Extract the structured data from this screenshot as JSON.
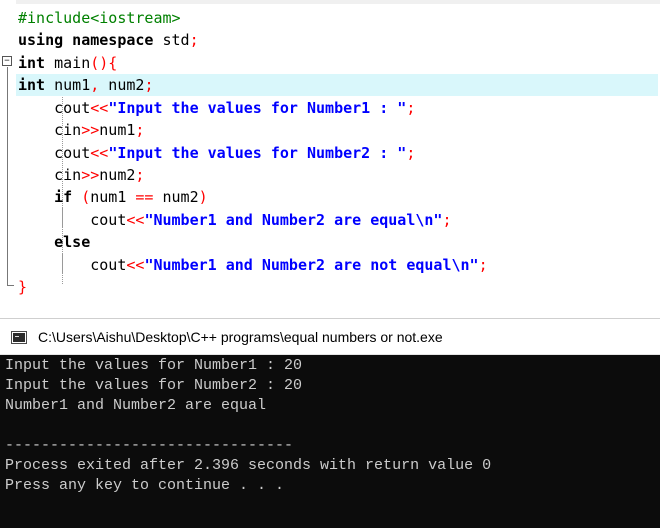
{
  "editor": {
    "lines": [
      {
        "parts": [
          {
            "t": "#include<iostream>",
            "c": "pp"
          }
        ]
      },
      {
        "parts": [
          {
            "t": "using namespace",
            "c": "kw"
          },
          {
            "t": " std",
            "c": "id"
          },
          {
            "t": ";",
            "c": "op"
          }
        ]
      },
      {
        "parts": [
          {
            "t": "int",
            "c": "kw"
          },
          {
            "t": " main",
            "c": "id"
          },
          {
            "t": "(){",
            "c": "op"
          }
        ]
      },
      {
        "parts": [
          {
            "t": "int",
            "c": "kw"
          },
          {
            "t": " num1",
            "c": "id"
          },
          {
            "t": ",",
            "c": "op"
          },
          {
            "t": " num2",
            "c": "id"
          },
          {
            "t": ";",
            "c": "op"
          }
        ]
      },
      {
        "parts": [
          {
            "t": "    cout",
            "c": "id"
          },
          {
            "t": "<<",
            "c": "op"
          },
          {
            "t": "\"Input the values for Number1 : \"",
            "c": "str"
          },
          {
            "t": ";",
            "c": "op"
          }
        ]
      },
      {
        "parts": [
          {
            "t": "    cin",
            "c": "id"
          },
          {
            "t": ">>",
            "c": "op"
          },
          {
            "t": "num1",
            "c": "id"
          },
          {
            "t": ";",
            "c": "op"
          }
        ]
      },
      {
        "parts": [
          {
            "t": "    cout",
            "c": "id"
          },
          {
            "t": "<<",
            "c": "op"
          },
          {
            "t": "\"Input the values for Number2 : \"",
            "c": "str"
          },
          {
            "t": ";",
            "c": "op"
          }
        ]
      },
      {
        "parts": [
          {
            "t": "    cin",
            "c": "id"
          },
          {
            "t": ">>",
            "c": "op"
          },
          {
            "t": "num2",
            "c": "id"
          },
          {
            "t": ";",
            "c": "op"
          }
        ]
      },
      {
        "parts": [
          {
            "t": "    if",
            "c": "kw"
          },
          {
            "t": " (",
            "c": "op"
          },
          {
            "t": "num1 ",
            "c": "id"
          },
          {
            "t": "==",
            "c": "op"
          },
          {
            "t": " num2",
            "c": "id"
          },
          {
            "t": ")",
            "c": "op"
          }
        ]
      },
      {
        "parts": [
          {
            "t": "        cout",
            "c": "id"
          },
          {
            "t": "<<",
            "c": "op"
          },
          {
            "t": "\"Number1 and Number2 are equal\\n\"",
            "c": "str"
          },
          {
            "t": ";",
            "c": "op"
          }
        ]
      },
      {
        "parts": [
          {
            "t": "    else",
            "c": "kw"
          }
        ]
      },
      {
        "parts": [
          {
            "t": "        cout",
            "c": "id"
          },
          {
            "t": "<<",
            "c": "op"
          },
          {
            "t": "\"Number1 and Number2 are not equal\\n\"",
            "c": "str"
          },
          {
            "t": ";",
            "c": "op"
          }
        ]
      },
      {
        "parts": [
          {
            "t": "}",
            "c": "op"
          }
        ]
      }
    ],
    "current_line": 4,
    "fold_marker": "−",
    "colors": {
      "current_line_bg": "#d9f7fb",
      "keyword": "#000000",
      "preprocessor": "#008000",
      "operator": "#ff0000",
      "string": "#0000ff"
    }
  },
  "console": {
    "title": "C:\\Users\\Aishu\\Desktop\\C++ programs\\equal numbers or not.exe",
    "icon": "console-window-icon",
    "output": [
      "Input the values for Number1 : 20",
      "Input the values for Number2 : 20",
      "Number1 and Number2 are equal",
      "",
      "--------------------------------",
      "Process exited after 2.396 seconds with return value 0",
      "Press any key to continue . . ."
    ],
    "colors": {
      "background": "#0c0c0c",
      "text": "#cccccc"
    }
  }
}
